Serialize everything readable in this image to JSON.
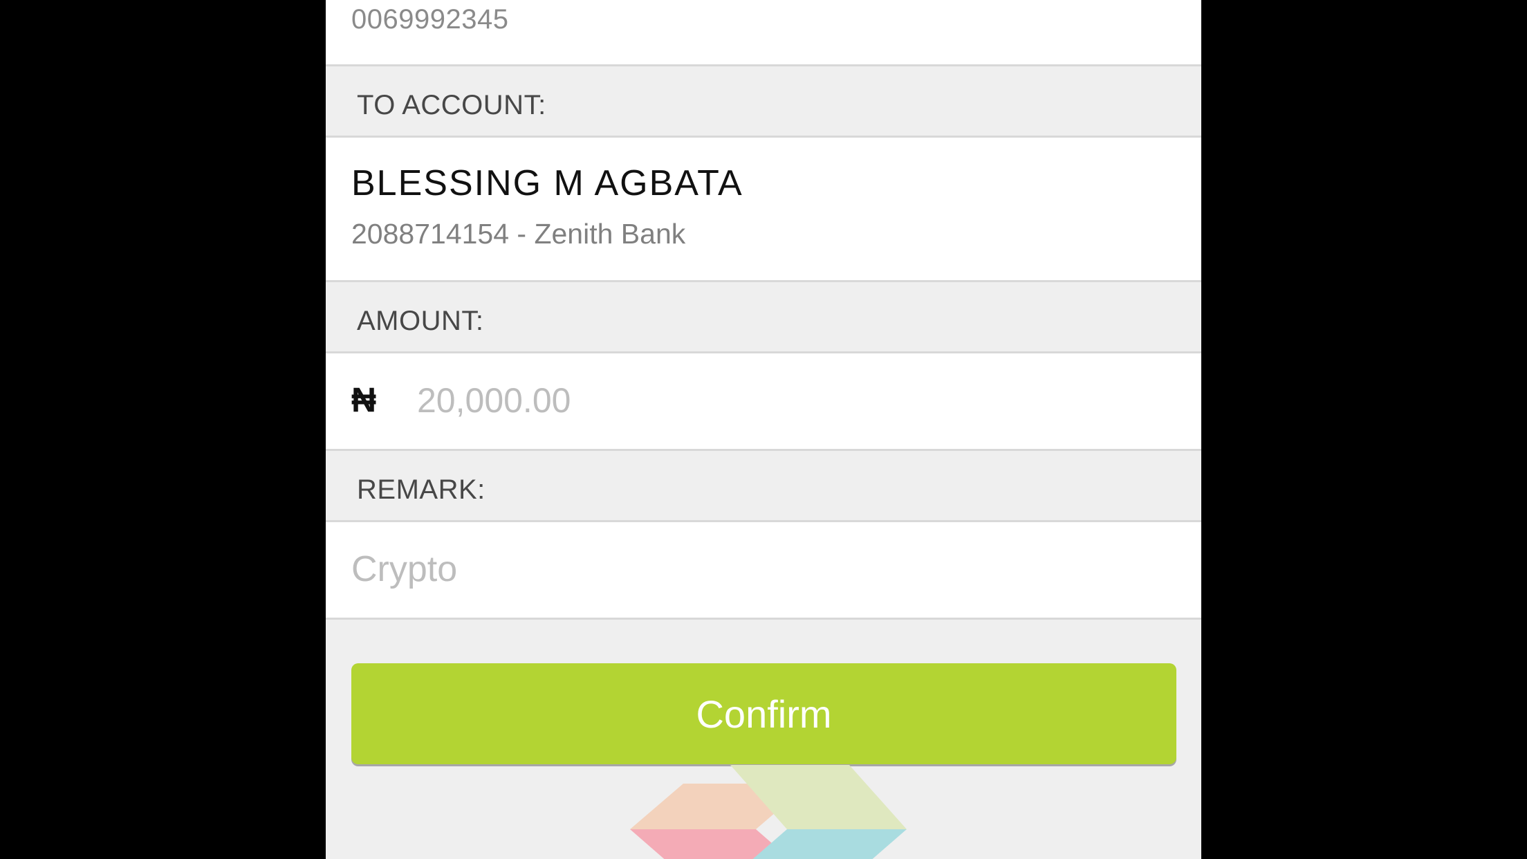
{
  "from_account": {
    "number": "0069992345"
  },
  "to_account": {
    "label": "TO ACCOUNT:",
    "name": "BLESSING M AGBATA",
    "detail": "2088714154 - Zenith Bank"
  },
  "amount": {
    "label": "AMOUNT:",
    "currency_symbol": "₦",
    "placeholder": "20,000.00"
  },
  "remark": {
    "label": "REMARK:",
    "placeholder": "Crypto"
  },
  "confirm_button": {
    "label": "Confirm"
  },
  "logo": {
    "icon": "bank-logo-icon"
  },
  "colors": {
    "accent": "#b3d433",
    "background": "#efefef",
    "outer": "#000000"
  }
}
